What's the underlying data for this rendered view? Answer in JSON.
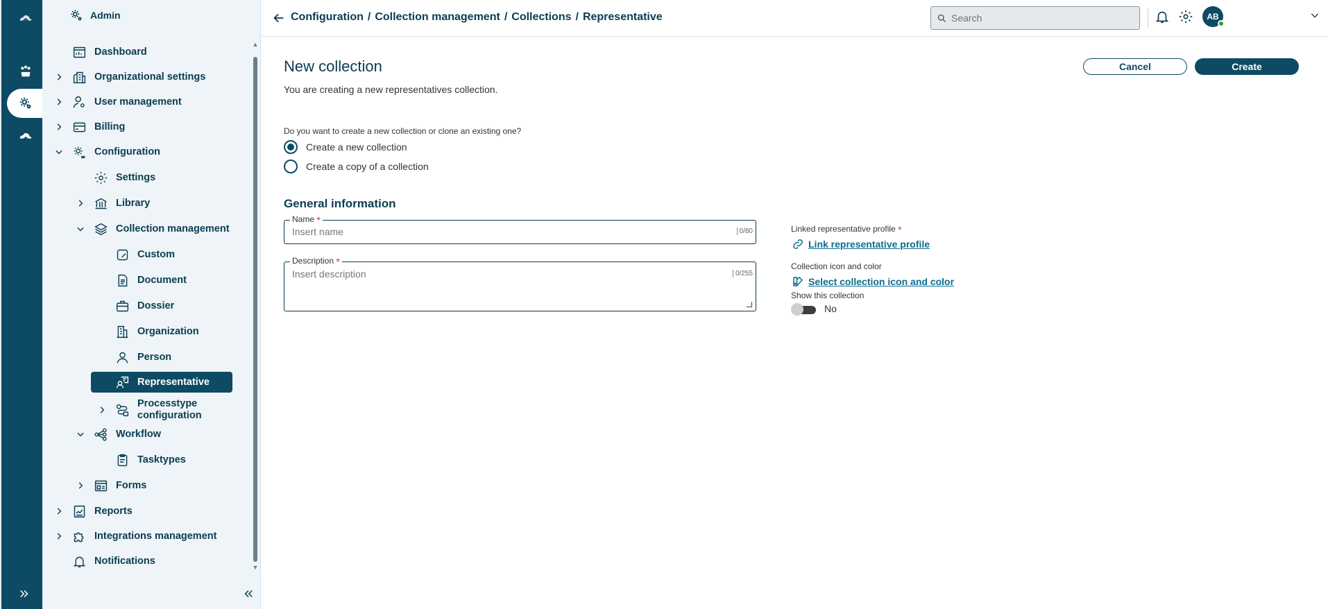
{
  "rail": {
    "items": [
      {
        "name": "cloud-logo-icon"
      },
      {
        "name": "paw-icon"
      },
      {
        "name": "admin-gear-icon"
      },
      {
        "name": "cloud-icon"
      }
    ]
  },
  "sidebar": {
    "header": "Admin",
    "items": [
      {
        "label": "Dashboard"
      },
      {
        "label": "Organizational settings"
      },
      {
        "label": "User management"
      },
      {
        "label": "Billing"
      },
      {
        "label": "Configuration"
      },
      {
        "label": "Settings"
      },
      {
        "label": "Library"
      },
      {
        "label": "Collection management"
      },
      {
        "label": "Custom"
      },
      {
        "label": "Document"
      },
      {
        "label": "Dossier"
      },
      {
        "label": "Organization"
      },
      {
        "label": "Person"
      },
      {
        "label": "Representative"
      },
      {
        "label_line1": "Processtype",
        "label_line2": "configuration"
      },
      {
        "label": "Workflow"
      },
      {
        "label": "Tasktypes"
      },
      {
        "label": "Forms"
      },
      {
        "label": "Reports"
      },
      {
        "label": "Integrations management"
      },
      {
        "label": "Notifications"
      }
    ]
  },
  "topbar": {
    "breadcrumb": [
      "Configuration",
      "/",
      "Collection management",
      "/",
      "Collections",
      "/",
      "Representative"
    ],
    "search_placeholder": "Search",
    "avatar_initials": "AB"
  },
  "main": {
    "title": "New collection",
    "subtitle": "You are creating a new representatives collection.",
    "cancel_label": "Cancel",
    "create_label": "Create",
    "question": "Do you want to create a new collection or clone an existing one?",
    "options": [
      {
        "label": "Create a new collection",
        "selected": true
      },
      {
        "label": "Create a copy of a collection",
        "selected": false
      }
    ],
    "section_title": "General information",
    "name_field": {
      "label": "Name",
      "placeholder": "Insert name",
      "counter": "0/80"
    },
    "description_field": {
      "label": "Description",
      "placeholder": "Insert description",
      "counter": "0/255"
    },
    "linked_profile_label": "Linked representative profile",
    "linked_profile_link": "Link representative profile",
    "icon_color_label": "Collection icon and color",
    "icon_color_link": "Select collection icon and color",
    "show_label": "Show this collection",
    "show_value": "No",
    "required_mark": "*"
  },
  "colors": {
    "primary": "#0d4a63",
    "sidebar_bg": "#eef4f7",
    "link": "#0b6c8f",
    "required": "#d32f2f"
  }
}
